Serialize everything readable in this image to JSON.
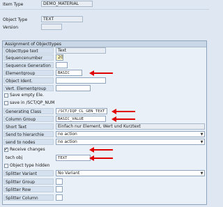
{
  "header": {
    "item_type_label": "Item Type",
    "item_type_value": "DEMO_MATERIAL",
    "object_type_label": "Object Type",
    "object_type_value": "TEXT",
    "version_label": "Version",
    "version_value": ""
  },
  "group": {
    "title": "Assignment of Objecttypes",
    "objecttype_text_label": "Objecttype text",
    "objecttype_text_value": "Text",
    "sequencenumber_label": "Sequencenumber",
    "sequencenumber_value": "20",
    "sequence_generation_label": "Sequence Generation",
    "sequence_generation_value": "",
    "elementgroup_label": "Elementgroup",
    "elementgroup_value": "BASIC",
    "object_ident_label": "Object Ident.",
    "object_ident_value": "",
    "vert_elementgroup_label": "Vert. Elementgroup",
    "vert_elementgroup_value": "",
    "save_empty_label": "Save empty Ele.",
    "save_empty_checked": false,
    "save_in_label": "save in /SCT/QP_NUM",
    "save_in_checked": false,
    "generating_class_label": "Generating Class",
    "generating_class_value": "/SCT/IQP_CL_GEN_TEXT",
    "column_group_label": "Column Group",
    "column_group_value": "BASIC_VALUE",
    "short_text_label": "Short Text",
    "short_text_value": "Einfach nur Element, Wert und Kurztext",
    "send_hierarchie_label": "Send to hierarchie",
    "send_hierarchie_value": "no action",
    "send_nodes_label": "send to nodes",
    "send_nodes_value": "no action",
    "receive_changes_label": "Receive changes",
    "receive_changes_checked": true,
    "tech_obj_label": "tech obj",
    "tech_obj_value": "TEXT",
    "object_type_hidden_label": "Object type hidden",
    "object_type_hidden_checked": false,
    "splitter_variant_label": "Splitter Variant",
    "splitter_variant_value": "No Variant",
    "splitter_group_label": "Splitter Group",
    "splitter_group_value": "",
    "splitter_row_label": "Splitter Row",
    "splitter_row_value": "",
    "splitter_column_label": "Splitter Column",
    "splitter_column_value": ""
  },
  "icons": {
    "dropdown": "triangle-down-icon",
    "annotation_arrow": "red-left-arrow"
  },
  "colors": {
    "annotation_arrow": "#e00000",
    "background": "#dfe8f2"
  }
}
